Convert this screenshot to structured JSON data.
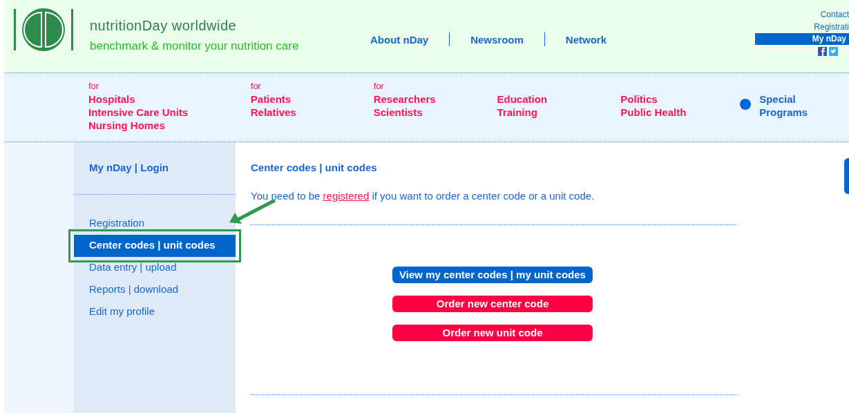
{
  "header": {
    "title": "nutritionDay worldwide",
    "tagline": "benchmark & monitor your nutrition care",
    "nav": [
      {
        "label": "About nDay"
      },
      {
        "label": "Newsroom"
      },
      {
        "label": "Network"
      }
    ],
    "utility_links": [
      {
        "label": "Contact",
        "selected": false
      },
      {
        "label": "Registrati",
        "selected": false
      },
      {
        "label": "My nDay",
        "selected": true
      }
    ]
  },
  "audiences": [
    {
      "prefix": "for",
      "links": [
        "Hospitals",
        "Intensive Care Units",
        "Nursing Homes"
      ]
    },
    {
      "prefix": "for",
      "links": [
        "Patients",
        "Relatives"
      ]
    },
    {
      "prefix": "for",
      "links": [
        "Researchers",
        "Scientists"
      ]
    },
    {
      "links": [
        "Education",
        "Training"
      ]
    },
    {
      "links": [
        "Politics",
        "Public Health"
      ]
    },
    {
      "links": [
        "Special",
        "Programs"
      ],
      "dot": true
    }
  ],
  "sidebar": {
    "heading": "My nDay | Login",
    "items": [
      {
        "label": "Registration",
        "selected": false
      },
      {
        "label": "Center codes | unit codes",
        "selected": true
      },
      {
        "label": "Data entry | upload",
        "selected": false
      },
      {
        "label": "Reports | download",
        "selected": false
      },
      {
        "label": "Edit my profile",
        "selected": false
      }
    ]
  },
  "main": {
    "title": "Center codes | unit codes",
    "message_before": "You need to be",
    "link": "registered",
    "message_after": "if you want to order a center code or a unit code.",
    "buttons": [
      {
        "label": "View my center codes | my unit codes",
        "color": "#0066cc"
      },
      {
        "label": "Order new center code",
        "color": "#ff0044"
      },
      {
        "label": "Order new unit code",
        "color": "#ff0044"
      }
    ]
  }
}
